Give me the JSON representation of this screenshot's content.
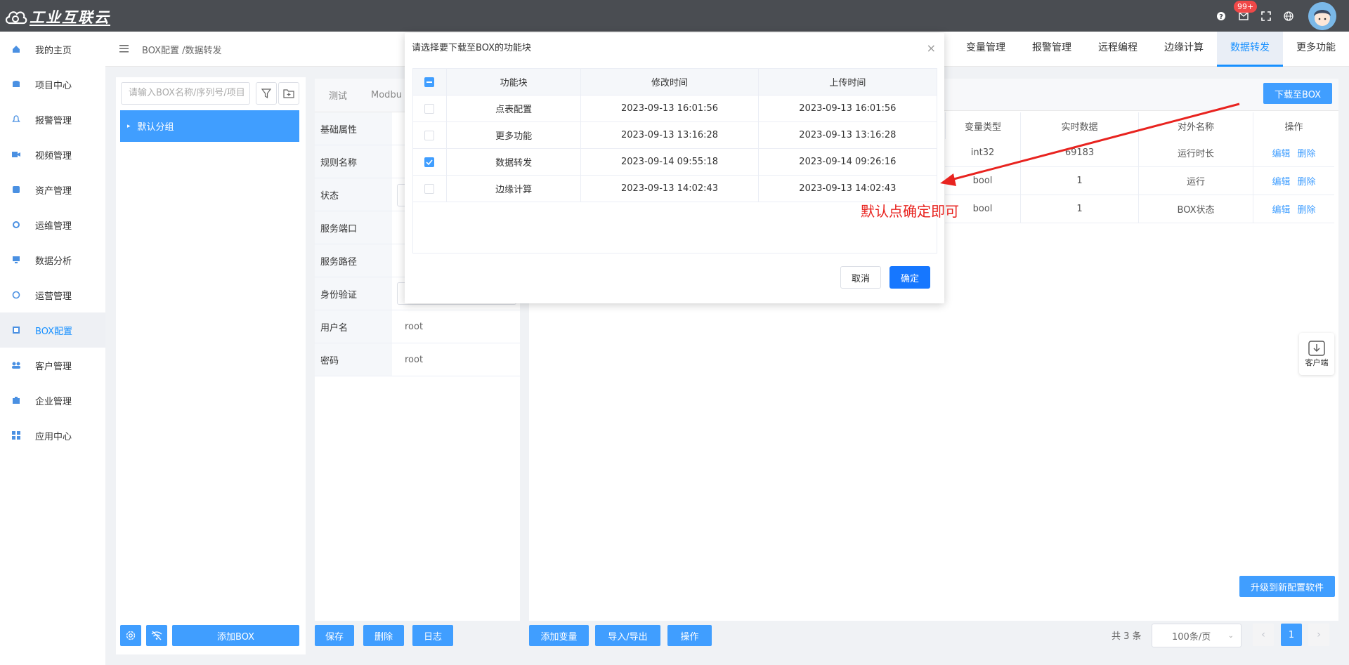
{
  "app": {
    "logo_text": "工业互联云"
  },
  "topbar": {
    "badge": "99+"
  },
  "sidebar": {
    "items": [
      {
        "label": "我的主页",
        "icon": "home-icon"
      },
      {
        "label": "项目中心",
        "icon": "database-icon"
      },
      {
        "label": "报警管理",
        "icon": "bell-icon"
      },
      {
        "label": "视频管理",
        "icon": "video-icon"
      },
      {
        "label": "资产管理",
        "icon": "asset-icon"
      },
      {
        "label": "运维管理",
        "icon": "gear-icon"
      },
      {
        "label": "数据分析",
        "icon": "monitor-icon"
      },
      {
        "label": "运营管理",
        "icon": "cycle-icon"
      },
      {
        "label": "BOX配置",
        "icon": "box-config-icon",
        "active": true
      },
      {
        "label": "客户管理",
        "icon": "users-icon"
      },
      {
        "label": "企业管理",
        "icon": "briefcase-icon"
      },
      {
        "label": "应用中心",
        "icon": "grid-icon"
      }
    ]
  },
  "header": {
    "breadcrumb": "BOX配置 /数据转发",
    "tabs": [
      "变量管理",
      "报警管理",
      "远程编程",
      "边缘计算",
      "数据转发",
      "更多功能"
    ],
    "active_tab": "数据转发"
  },
  "left_panel": {
    "search_placeholder": "请输入BOX名称/序列号/项目",
    "group": "默认分组",
    "add_box": "添加BOX"
  },
  "middle_panel": {
    "tabs": [
      "测试",
      "Modbu"
    ],
    "rows": [
      {
        "label": "基础属性",
        "value": ""
      },
      {
        "label": "规则名称",
        "value": ""
      },
      {
        "label": "状态",
        "value": ""
      },
      {
        "label": "服务端口",
        "value": ""
      },
      {
        "label": "服务路径",
        "value": ""
      },
      {
        "label": "身份验证",
        "value": ""
      },
      {
        "label": "用户名",
        "value": "root"
      },
      {
        "label": "密码",
        "value": "root"
      }
    ],
    "buttons": {
      "save": "保存",
      "delete": "删除",
      "log": "日志"
    }
  },
  "right_panel": {
    "download_button": "下载至BOX",
    "columns": [
      "变量类型",
      "实时数据",
      "对外名称",
      "操作"
    ],
    "rows": [
      {
        "type": "int32",
        "value": "69183",
        "name": "运行时长"
      },
      {
        "type": "bool",
        "value": "1",
        "name": "运行"
      },
      {
        "type": "bool",
        "value": "1",
        "name": "BOX状态"
      }
    ],
    "edit": "编辑",
    "remove": "删除",
    "upgrade_button": "升级到新配置软件",
    "buttons": {
      "add_var": "添加变量",
      "import_export": "导入/导出",
      "operate": "操作"
    },
    "pager": {
      "total": "共 3 条",
      "page_size": "100条/页",
      "current": "1"
    }
  },
  "client_widget": {
    "label": "客户端"
  },
  "modal": {
    "title": "请选择要下载至BOX的功能块",
    "columns": [
      "功能块",
      "修改时间",
      "上传时间"
    ],
    "rows": [
      {
        "name": "点表配置",
        "modified": "2023-09-13 16:01:56",
        "uploaded": "2023-09-13 16:01:56",
        "checked": false
      },
      {
        "name": "更多功能",
        "modified": "2023-09-13 13:16:28",
        "uploaded": "2023-09-13 13:16:28",
        "checked": false
      },
      {
        "name": "数据转发",
        "modified": "2023-09-14 09:55:18",
        "uploaded": "2023-09-14 09:26:16",
        "checked": true
      },
      {
        "name": "边缘计算",
        "modified": "2023-09-13 14:02:43",
        "uploaded": "2023-09-13 14:02:43",
        "checked": false
      }
    ],
    "cancel": "取消",
    "confirm": "确定"
  },
  "annotation": "默认点确定即可",
  "colors": {
    "primary": "#409eff",
    "topbar": "#4a4d52",
    "annotation": "#e8231f"
  }
}
